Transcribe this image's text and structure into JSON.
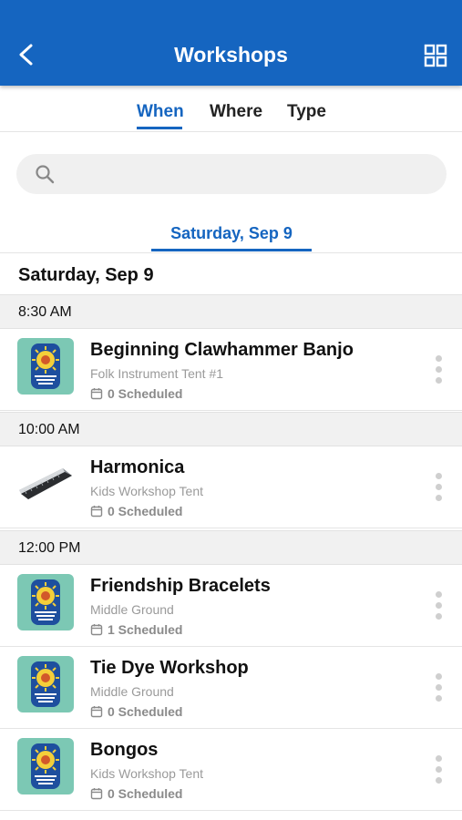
{
  "header": {
    "title": "Workshops",
    "back_icon": "chevron-left-icon",
    "view_icon": "grid-view-icon",
    "color": "#1565c0"
  },
  "tabs": [
    {
      "label": "When",
      "active": true
    },
    {
      "label": "Where",
      "active": false
    },
    {
      "label": "Type",
      "active": false
    }
  ],
  "search": {
    "placeholder": "",
    "value": "",
    "icon": "search-icon"
  },
  "date_tab": {
    "label": "Saturday, Sep 9"
  },
  "day_heading": "Saturday, Sep 9",
  "groups": [
    {
      "time": "8:30 AM",
      "items": [
        {
          "title": "Beginning Clawhammer Banjo",
          "location": "Folk Instrument Tent #1",
          "scheduled": "0 Scheduled",
          "thumb": "festival-logo"
        }
      ]
    },
    {
      "time": "10:00 AM",
      "items": [
        {
          "title": "Harmonica",
          "location": "Kids Workshop Tent",
          "scheduled": "0 Scheduled",
          "thumb": "harmonica-photo"
        }
      ]
    },
    {
      "time": "12:00 PM",
      "items": [
        {
          "title": "Friendship Bracelets",
          "location": "Middle Ground",
          "scheduled": "1 Scheduled",
          "thumb": "festival-logo"
        },
        {
          "title": "Tie Dye Workshop",
          "location": "Middle Ground",
          "scheduled": "0 Scheduled",
          "thumb": "festival-logo"
        },
        {
          "title": "Bongos",
          "location": "Kids Workshop Tent",
          "scheduled": "0 Scheduled",
          "thumb": "festival-logo"
        }
      ]
    }
  ]
}
